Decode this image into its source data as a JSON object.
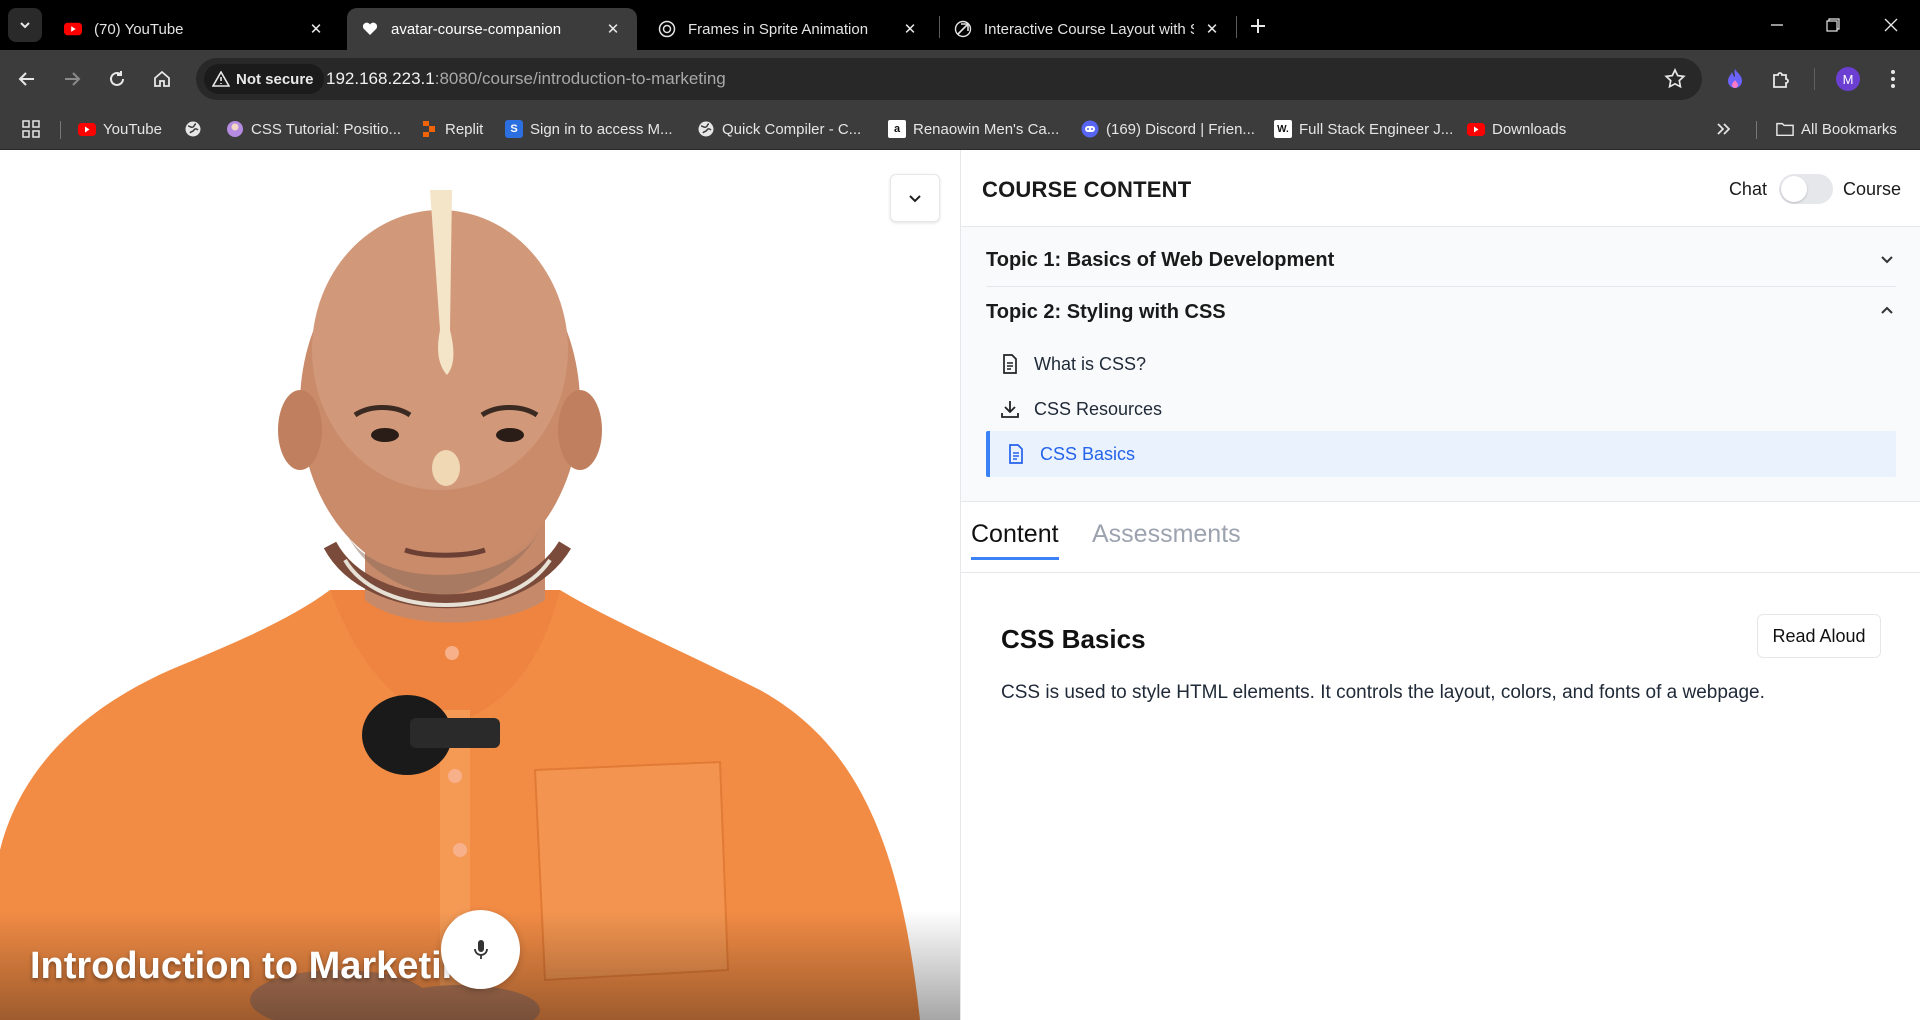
{
  "browser": {
    "tabs": [
      {
        "title": "(70) YouTube",
        "icon": "youtube-icon"
      },
      {
        "title": "avatar-course-companion",
        "icon": "heart-icon"
      },
      {
        "title": "Frames in Sprite Animation",
        "icon": "openai-icon"
      },
      {
        "title": "Interactive Course Layout with S",
        "icon": "link-icon"
      }
    ],
    "security_label": "Not secure",
    "url_host": "192.168.223.1",
    "url_path": ":8080/course/introduction-to-marketing",
    "profile_initial": "M",
    "bookmarks": [
      {
        "label": "YouTube",
        "icon": "youtube-icon"
      },
      {
        "label": "",
        "icon": "globe-icon"
      },
      {
        "label": "CSS Tutorial: Positio...",
        "icon": "site-icon"
      },
      {
        "label": "Replit",
        "icon": "replit-icon"
      },
      {
        "label": "Sign in to access M...",
        "icon": "s-icon"
      },
      {
        "label": "Quick Compiler - C...",
        "icon": "globe-icon"
      },
      {
        "label": "Renaowin Men's Ca...",
        "icon": "amazon-icon"
      },
      {
        "label": "(169) Discord | Frien...",
        "icon": "discord-icon"
      },
      {
        "label": "Full Stack Engineer J...",
        "icon": "w-icon"
      },
      {
        "label": "Downloads",
        "icon": "youtube-icon"
      }
    ],
    "all_bookmarks": "All Bookmarks"
  },
  "video": {
    "title": "Introduction to Marketing"
  },
  "panel": {
    "title": "COURSE CONTENT",
    "toggle_left": "Chat",
    "toggle_right": "Course",
    "topics": [
      {
        "title": "Topic 1: Basics of Web Development",
        "expanded": false
      },
      {
        "title": "Topic 2: Styling with CSS",
        "expanded": true
      }
    ],
    "lessons": [
      {
        "title": "What is CSS?",
        "icon": "document-icon"
      },
      {
        "title": "CSS Resources",
        "icon": "download-icon"
      },
      {
        "title": "CSS Basics",
        "icon": "document-icon",
        "active": true
      }
    ],
    "tabs": [
      "Content",
      "Assessments"
    ],
    "content": {
      "title": "CSS Basics",
      "read_aloud": "Read Aloud",
      "body": "CSS is used to style HTML elements. It controls the layout, colors, and fonts of a webpage."
    }
  },
  "colors": {
    "accent": "#3b82f6",
    "active_lesson_bg": "#eaf2fe",
    "robe": "#f28c45"
  }
}
